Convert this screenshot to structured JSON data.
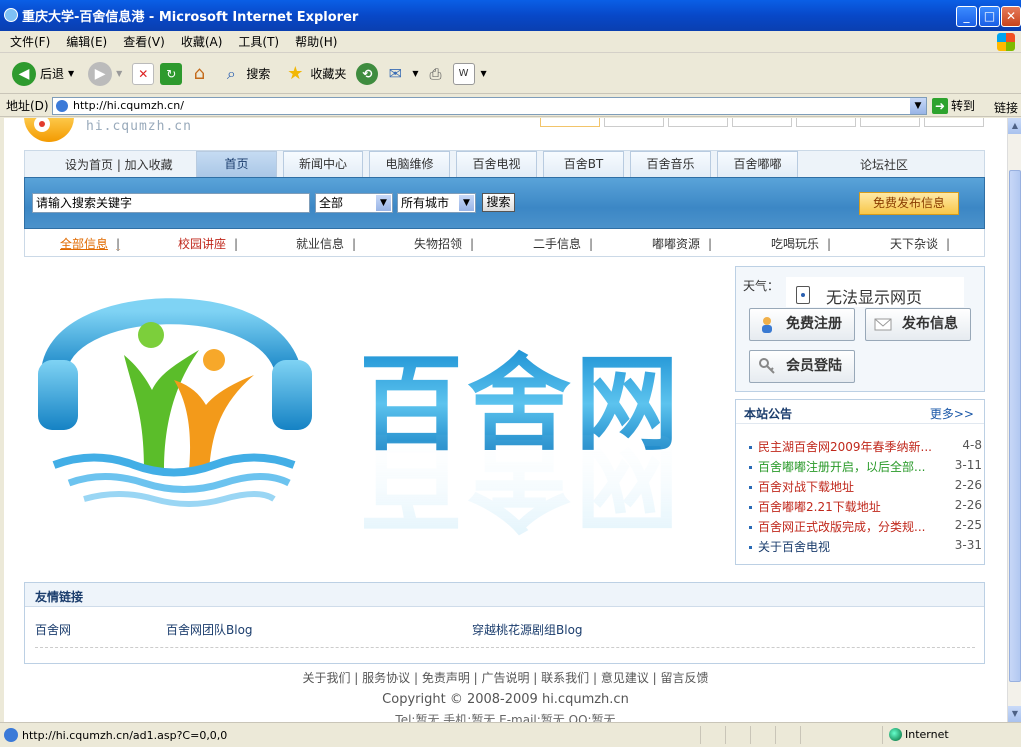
{
  "window": {
    "title": "重庆大学-百舍信息港 - Microsoft Internet Explorer",
    "min": "_",
    "max": "□",
    "close": "✕"
  },
  "menu": [
    "文件(F)",
    "编辑(E)",
    "查看(V)",
    "收藏(A)",
    "工具(T)",
    "帮助(H)"
  ],
  "toolbar": {
    "back": "后退",
    "search": "搜索",
    "favorites": "收藏夹"
  },
  "address": {
    "label": "地址(D)",
    "url": "http://hi.cqumzh.cn/",
    "go": "转到",
    "links": "链接"
  },
  "page": {
    "logo_url": "hi.cqumzh.cn",
    "home_links": "设为首页 | 加入收藏",
    "tabs": [
      "首页",
      "新闻中心",
      "电脑维修",
      "百舍电视",
      "百舍BT",
      "百舍音乐",
      "百舍嘟嘟"
    ],
    "forum": "论坛社区",
    "search": {
      "placeholder": "请输入搜索关键字",
      "scope": "全部",
      "city": "所有城市",
      "button": "搜索",
      "publish": "免费发布信息"
    },
    "categories": [
      "全部信息",
      "校园讲座",
      "就业信息",
      "失物招领",
      "二手信息",
      "嘟嘟资源",
      "吃喝玩乐",
      "天下杂谈"
    ],
    "banner_text": "百舍网",
    "weather": {
      "label": "天气：",
      "frame_text": "无法显示网页"
    },
    "buttons": {
      "register": "免费注册",
      "publish": "发布信息",
      "login": "会员登陆"
    },
    "notice": {
      "title": "本站公告",
      "more": "更多>>",
      "items": [
        {
          "text": "民主湖百舍网2009年春季纳新...",
          "date": "4-8",
          "color": "#c0281c"
        },
        {
          "text": "百舍嘟嘟注册开启，以后全部...",
          "date": "3-11",
          "color": "#2a9a2a"
        },
        {
          "text": "百舍对战下载地址",
          "date": "2-26",
          "color": "#c0281c"
        },
        {
          "text": "百舍嘟嘟2.21下载地址",
          "date": "2-26",
          "color": "#c0281c"
        },
        {
          "text": "百舍网正式改版完成，分类规...",
          "date": "2-25",
          "color": "#c0281c"
        },
        {
          "text": "关于百舍电视",
          "date": "3-31",
          "color": "#1b3d6d"
        }
      ]
    },
    "friends": {
      "title": "友情链接",
      "links": [
        "百舍网",
        "百舍网团队Blog",
        "穿越桃花源剧组Blog"
      ]
    },
    "footer": {
      "links": "关于我们 | 服务协议 | 免责声明 | 广告说明 | 联系我们 | 意见建议 | 留言反馈",
      "copyright": "Copyright © 2008-2009 hi.cqumzh.cn",
      "contact": "Tel:暂无 手机:暂无 E-mail:暂无 QQ:暂无"
    }
  },
  "status": {
    "url": "http://hi.cqumzh.cn/ad1.asp?C=0,0,0",
    "zone": "Internet"
  }
}
